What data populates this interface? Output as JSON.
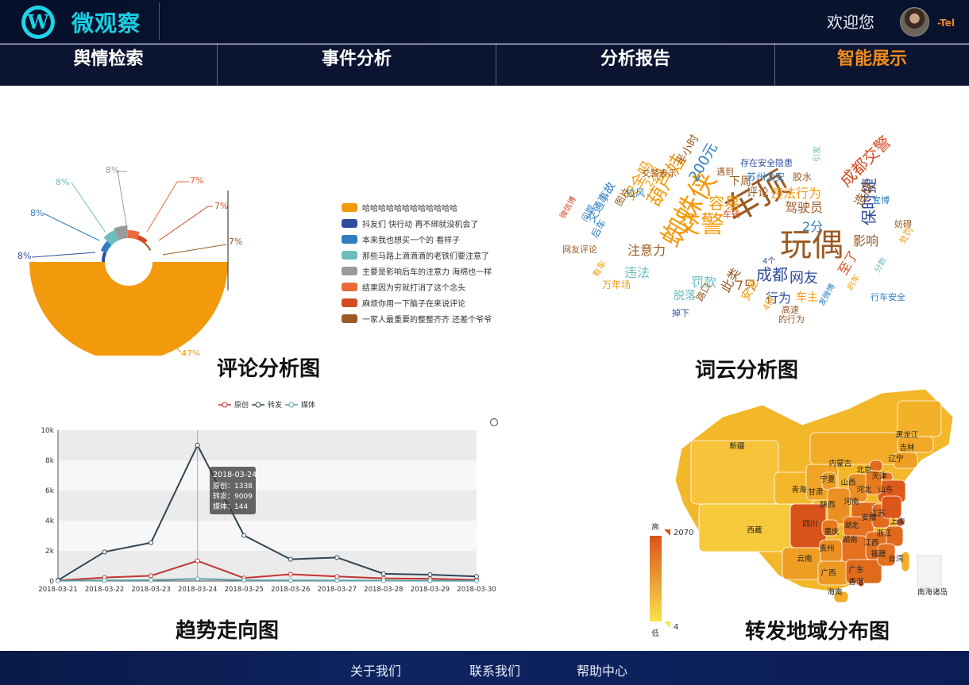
{
  "header": {
    "logo_glyph": "W",
    "brand": "微观察",
    "welcome": "欢迎您",
    "user_tag": "-Tel"
  },
  "nav": {
    "items": [
      {
        "label": "舆情检索"
      },
      {
        "label": "事件分析"
      },
      {
        "label": "分析报告"
      },
      {
        "label": "智能展示"
      }
    ],
    "active_index": 3,
    "active_color": "#f08c1c"
  },
  "panels": {
    "comment_title": "评论分析图",
    "wordcloud_title": "词云分析图",
    "trend_title": "趋势走向图",
    "map_title": "转发地域分布图"
  },
  "chart_data": [
    {
      "type": "pie",
      "variant": "rose",
      "slices": [
        {
          "label": "哈哈哈哈哈哈哈哈哈哈哈哈",
          "pct_label": "47%",
          "color": "#f39a0c"
        },
        {
          "label": "抖友们 快行动 再不绑就没机会了",
          "pct_label": "8%",
          "color": "#2f4d9c"
        },
        {
          "label": "本来我也想买一个的 看样子",
          "pct_label": "8%",
          "color": "#2e7ec0"
        },
        {
          "label": "那些马路上滴滴滴的老铁们要注意了",
          "pct_label": "8%",
          "color": "#6fbcbf"
        },
        {
          "label": "主要是影响后车的注意力 海绵也一样",
          "pct_label": "8%",
          "color": "#9a9a9a"
        },
        {
          "label": "结果因为穷就打消了这个念头",
          "pct_label": "7%",
          "color": "#ea6a3d"
        },
        {
          "label": "麻烦你用一下脑子在来说评论",
          "pct_label": "7%",
          "color": "#d14b24"
        },
        {
          "label": "一家人最重要的整整齐齐 还差个爷爷",
          "pct_label": "7%",
          "color": "#9b5a23"
        }
      ],
      "legend_position": "right"
    },
    {
      "type": "line",
      "legend": [
        "原创",
        "转发",
        "媒体"
      ],
      "x": [
        "2018-03-21",
        "2018-03-22",
        "2018-03-23",
        "2018-03-24",
        "2018-03-25",
        "2018-03-26",
        "2018-03-27",
        "2018-03-28",
        "2018-03-29",
        "2018-03-30"
      ],
      "series": [
        {
          "name": "原创",
          "color": "#c23531",
          "values": [
            30,
            230,
            350,
            1338,
            200,
            450,
            300,
            180,
            150,
            80
          ]
        },
        {
          "name": "转发",
          "color": "#2f4554",
          "values": [
            50,
            1930,
            2540,
            9009,
            3020,
            1440,
            1560,
            480,
            420,
            300
          ]
        },
        {
          "name": "媒体",
          "color": "#61a0a8",
          "values": [
            10,
            40,
            60,
            144,
            50,
            40,
            30,
            25,
            20,
            10
          ]
        }
      ],
      "ylim": [
        0,
        10000
      ],
      "yticks": [
        "0",
        "2k",
        "4k",
        "6k",
        "8k",
        "10k"
      ],
      "grid": "banded",
      "tooltip": {
        "title": "2018-03-24",
        "lines": [
          "原创：1338",
          "转发：9009",
          "媒体：144"
        ]
      }
    },
    {
      "type": "heatmap",
      "variant": "china-province-map",
      "scale": {
        "max_label": "高",
        "min_label": "低",
        "max_value": "2070",
        "min_value": "4"
      },
      "provinces": [
        "新疆",
        "西藏",
        "青海",
        "甘肃",
        "宁夏",
        "内蒙古",
        "黑龙江",
        "吉林",
        "辽宁",
        "北京",
        "天津",
        "山西",
        "山东",
        "河北",
        "河南",
        "陕西",
        "四川",
        "重庆",
        "湖北",
        "安徽",
        "江苏",
        "上海",
        "浙江",
        "湖南",
        "江西",
        "贵州",
        "云南",
        "广西",
        "广东",
        "福建",
        "台湾",
        "香港",
        "海南",
        "南海诸岛"
      ]
    }
  ],
  "wordcloud": {
    "words": [
      {
        "t": "车顶",
        "c": "#9b5a23"
      },
      {
        "t": "玩偶",
        "c": "#9b5a23"
      },
      {
        "t": "蜘蛛侠",
        "c": "#f39a0c"
      },
      {
        "t": "交警",
        "c": "#f39a0c"
      },
      {
        "t": "葫芦娃",
        "c": "#f39a0c"
      },
      {
        "t": "成都交警",
        "c": "#d14b24"
      },
      {
        "t": "保时捷",
        "c": "#2f4d9c"
      },
      {
        "t": "容易",
        "c": "#f39a0c"
      },
      {
        "t": "200元",
        "c": "#2e7ec0"
      },
      {
        "t": "成都",
        "c": "#2f4d9c"
      },
      {
        "t": "网友",
        "c": "#2f4d9c"
      },
      {
        "t": "注意力",
        "c": "#9b5a23"
      },
      {
        "t": "安全吗",
        "c": "#f39a0c"
      },
      {
        "t": "违法行为",
        "c": "#f39a0c"
      },
      {
        "t": "驾驶员",
        "c": "#9b5a23"
      },
      {
        "t": "评论",
        "c": "#9b5a23"
      },
      {
        "t": "罚款",
        "c": "#6fbcbf"
      },
      {
        "t": "7只",
        "c": "#9b5a23"
      },
      {
        "t": "行为",
        "c": "#2f4d9c"
      },
      {
        "t": "车主",
        "c": "#f39a0c"
      },
      {
        "t": "至了",
        "c": "#d14b24"
      },
      {
        "t": "影响",
        "c": "#9b5a23"
      },
      {
        "t": "造成",
        "c": "#9b5a23"
      },
      {
        "t": "违法",
        "c": "#6fbcbf"
      },
      {
        "t": "交通事故",
        "c": "#2e7ec0"
      },
      {
        "t": "半小时",
        "c": "#9b5a23"
      },
      {
        "t": "2分",
        "c": "#2e7ec0"
      },
      {
        "t": "下周",
        "c": "#9b5a23"
      },
      {
        "t": "安全",
        "c": "#f39a0c"
      },
      {
        "t": "此类",
        "c": "#9b5a23"
      },
      {
        "t": "路口",
        "c": "#9b5a23"
      },
      {
        "t": "脱落",
        "c": "#6fbcbf"
      },
      {
        "t": "万年场",
        "c": "#f39a0c"
      },
      {
        "t": "苏州公安",
        "c": "#2e7ec0"
      },
      {
        "t": "存在安全隐患",
        "c": "#2f4d9c"
      },
      {
        "t": "胶水",
        "c": "#9b5a23"
      },
      {
        "t": "网友评论",
        "c": "#9b5a23"
      },
      {
        "t": "后车",
        "c": "#2e7ec0"
      },
      {
        "t": "图片",
        "c": "#9b5a23"
      },
      {
        "t": "拉风",
        "c": "#2e7ec0"
      },
      {
        "t": "22日",
        "c": "#f39a0c"
      },
      {
        "t": "交警表示",
        "c": "#9b5a23"
      },
      {
        "t": "遇到",
        "c": "#9b5a23"
      },
      {
        "t": "车辆",
        "c": "#d14b24"
      },
      {
        "t": "高速",
        "c": "#9b5a23"
      },
      {
        "t": "的行为",
        "c": "#9b5a23"
      },
      {
        "t": "4辆",
        "c": "#f39a0c"
      },
      {
        "t": "掉下",
        "c": "#2f4d9c"
      },
      {
        "t": "有车",
        "c": "#f39a0c"
      },
      {
        "t": "4个",
        "c": "#2f4d9c"
      },
      {
        "t": "引发",
        "c": "#6fbcbf"
      },
      {
        "t": "妨碍",
        "c": "#9b5a23"
      },
      {
        "t": "宜博",
        "c": "#2e7ec0"
      },
      {
        "t": "处罚",
        "c": "#f39a0c"
      },
      {
        "t": "行车安全",
        "c": "#2e7ec0"
      },
      {
        "t": "问题",
        "c": "#2e7ec0"
      },
      {
        "t": "微信博",
        "c": "#d14b24"
      },
      {
        "t": "发微博",
        "c": "#2e7ec0"
      },
      {
        "t": "的车",
        "c": "#f39a0c"
      },
      {
        "t": "分数",
        "c": "#6fbcbf"
      }
    ]
  },
  "footer": {
    "links": [
      "关于我们",
      "联系我们",
      "帮助中心"
    ]
  }
}
